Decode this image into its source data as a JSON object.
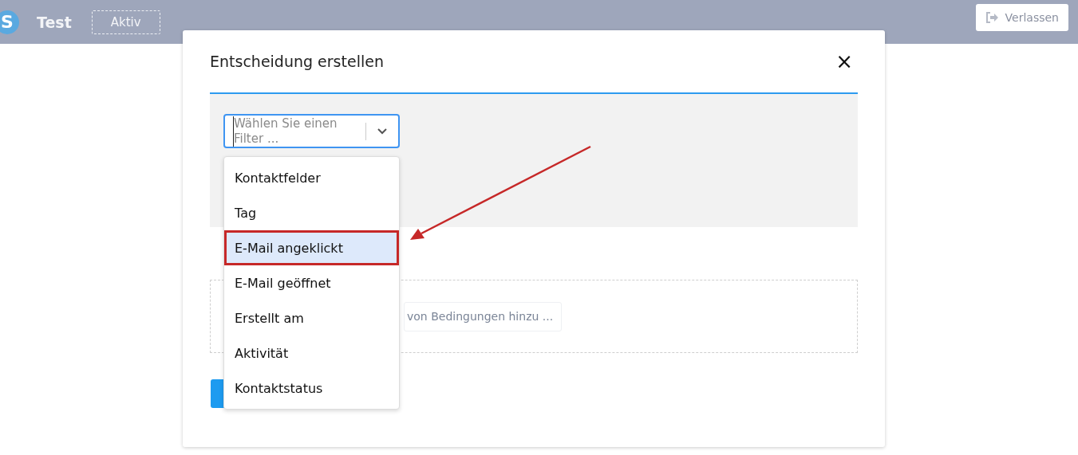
{
  "header": {
    "logo": "S",
    "title": "Test",
    "status": "Aktiv",
    "leave_button": "Verlassen"
  },
  "modal": {
    "title": "Entscheidung erstellen",
    "close": "×",
    "filter_select": {
      "placeholder": "Wählen Sie einen Filter ...",
      "expanded": true
    },
    "filter_options": [
      {
        "label": "Kontaktfelder",
        "selected": false
      },
      {
        "label": "Tag",
        "selected": false
      },
      {
        "label": "E-Mail angeklickt",
        "selected": true
      },
      {
        "label": "E-Mail geöffnet",
        "selected": false
      },
      {
        "label": "Erstellt am",
        "selected": false
      },
      {
        "label": "Aktivität",
        "selected": false
      },
      {
        "label": "Kontaktstatus",
        "selected": false
      }
    ],
    "add_group_button": "von Bedingungen hinzu ..."
  }
}
